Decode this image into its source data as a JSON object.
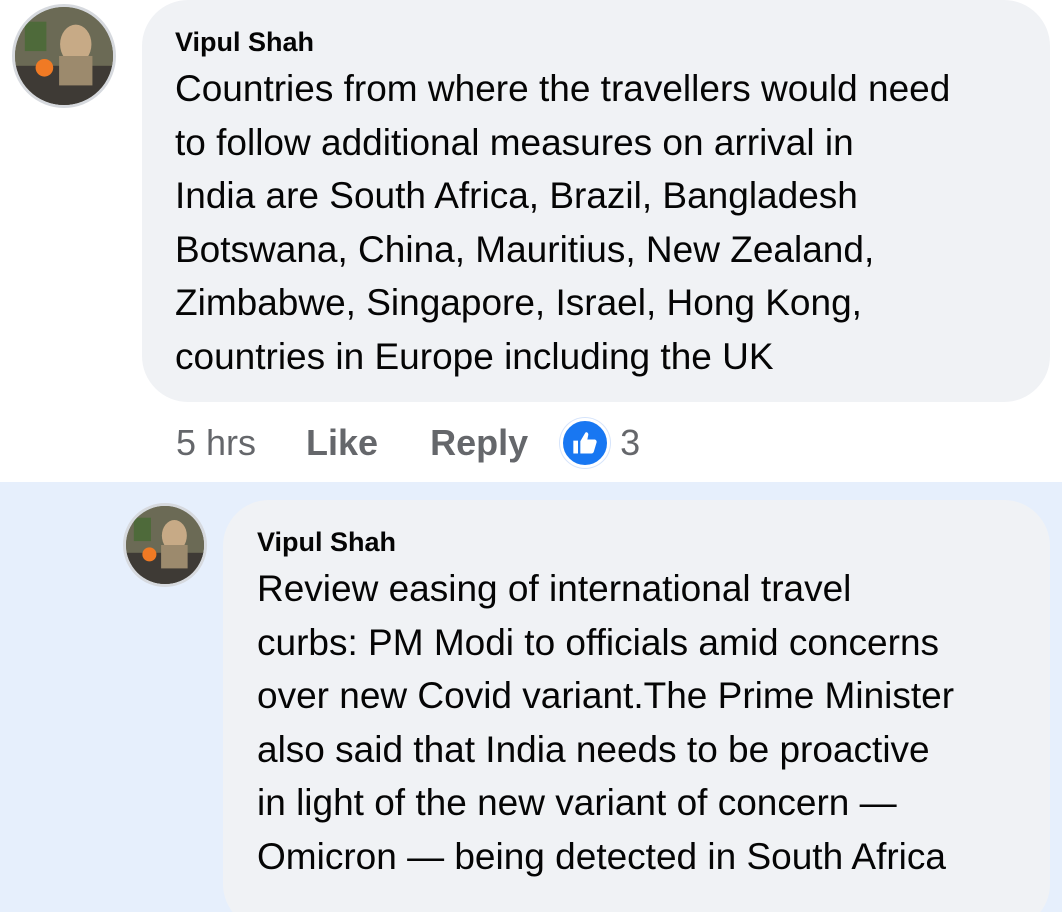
{
  "comment": {
    "author": "Vipul Shah",
    "text": "Countries from where the travellers would need\nto follow additional measures on arrival in\nIndia are South Africa, Brazil, Bangladesh\nBotswana, China, Mauritius, New Zealand,\nZimbabwe, Singapore, Israel, Hong Kong,\ncountries in Europe including the UK",
    "timestamp": "5 hrs",
    "like_label": "Like",
    "reply_label": "Reply",
    "reaction_icon": "thumbs-up-icon",
    "reaction_count": "3"
  },
  "reply": {
    "author": "Vipul Shah",
    "text": "Review easing of international travel\ncurbs: PM Modi to officials amid concerns\nover new Covid variant.The Prime Minister\nalso  said that India needs to be proactive\nin light of the new variant of concern —\nOmicron — being detected in South Africa"
  },
  "colors": {
    "bubble": "#f0f2f5",
    "reply_highlight": "#e6effc",
    "like_blue": "#1877f2",
    "secondary_text": "#65676b"
  }
}
